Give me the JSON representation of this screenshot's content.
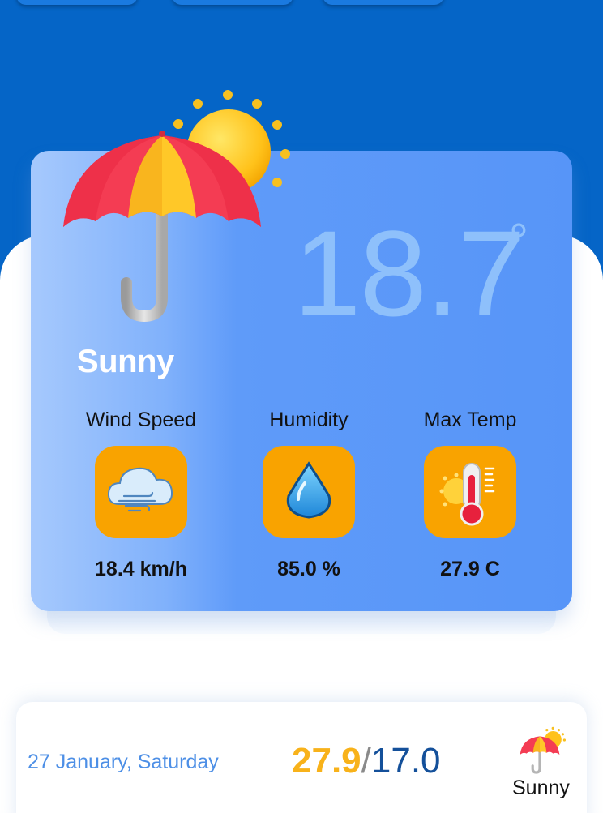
{
  "current": {
    "temperature": "18.7",
    "degree_symbol": "°",
    "condition": "Sunny",
    "icon": "umbrella-sun-icon"
  },
  "stats": [
    {
      "label": "Wind Speed",
      "value": "18.4 km/h",
      "icon": "wind-cloud-icon"
    },
    {
      "label": "Humidity",
      "value": "85.0 %",
      "icon": "water-drop-icon"
    },
    {
      "label": "Max Temp",
      "value": "27.9 C",
      "icon": "thermometer-icon"
    }
  ],
  "forecast": [
    {
      "date": "27 January, Saturday",
      "max": "27.9",
      "separator": "/",
      "min": "17.0",
      "condition": "Sunny",
      "icon": "umbrella-sun-icon"
    }
  ],
  "colors": {
    "header_blue": "#0565c7",
    "card_blue": "#5795f8",
    "tile_orange": "#f9a300",
    "max_temp_yellow": "#f8b21a",
    "min_temp_blue": "#14509a",
    "date_blue": "#4d8fe6"
  }
}
